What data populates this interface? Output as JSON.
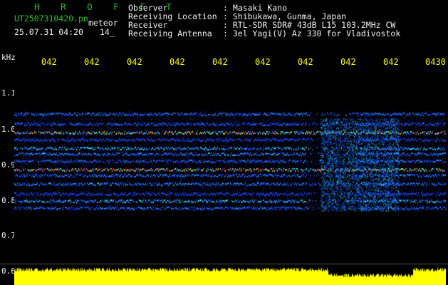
{
  "header": {
    "title": "H R O F F T",
    "file": "UT2507310420.pn",
    "mode": "meteor",
    "datetime": "25.07.31 04:20",
    "frame": "14_",
    "fields": [
      {
        "label": "Observer",
        "value": ": Masaki Kano"
      },
      {
        "label": "Receiving Location",
        "value": ": Shibukawa, Gunma, Japan"
      },
      {
        "label": "Receiver",
        "value": ": RTL-SDR SDR# 43dB L15 103.2MHz CW"
      },
      {
        "label": "Receiving Antenna",
        "value": ": 3el Yagi(V) Az 330 for Vladivostok"
      }
    ]
  },
  "axis": {
    "unit": "kHz",
    "time_ticks": [
      "042",
      "042",
      "042",
      "042",
      "042",
      "042",
      "042",
      "042",
      "042",
      "0430"
    ],
    "freq_ticks": [
      "1.1",
      "1.0",
      "0.9",
      "0.8",
      "0.7",
      "0.6"
    ]
  },
  "colors": {
    "label": "#27c31e",
    "value": "#f0f0f0",
    "ticks": "#ffff00",
    "signal_hot": "#ff3030",
    "background": "#000000"
  }
}
